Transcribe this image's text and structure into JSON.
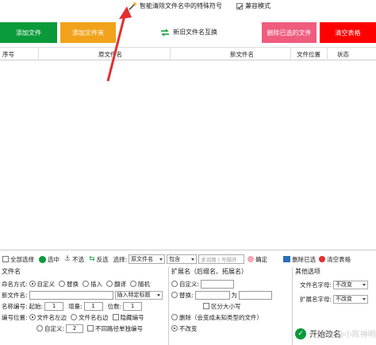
{
  "topbar": {
    "tool_label": "智能清除文件名中的特殊符号",
    "compat_label": "兼容模式",
    "compat_checked": true
  },
  "buttons": {
    "add_file": "添加文件",
    "add_folder": "添加文件夹",
    "swap_names": "新旧文件名互换",
    "delete_selected": "删除已选的文件",
    "clear_table": "清空表格"
  },
  "grid": {
    "columns": [
      "序号",
      "原文件名",
      "新文件名",
      "文件位置",
      "状态"
    ]
  },
  "toolbar2": {
    "select_all": "全部选择",
    "select": "选中",
    "deselect": "不选",
    "invert": "反选",
    "choose_label": "选择:",
    "field_value": "原文件名",
    "mode_value": "包含",
    "multi_placeholder": "多词用 | 号隔开",
    "confirm": "确定",
    "delete_selected": "删除已选",
    "clear_table": "清空表格"
  },
  "left_panel": {
    "title": "文件名",
    "naming_label": "命名方式:",
    "mode_custom": "自定义",
    "mode_replace": "替换",
    "mode_insert": "插入",
    "mode_translate": "翻译",
    "mode_random": "随机",
    "new_name_label": "新文件名:",
    "insert_select": "插入特定标题",
    "numbering_label": "名称编号:",
    "start_label": "起始:",
    "start_value": "1",
    "step_label": "增量:",
    "step_value": "1",
    "digits_label": "位数:",
    "digits_value": "1",
    "pos_label": "编号位置:",
    "pos_left": "文件名左边",
    "pos_right": "文件名右边",
    "hide_number": "隐藏编号",
    "custom_label": "自定义:",
    "custom_value": "2",
    "diff_path": "不同路径单独编号"
  },
  "mid_panel": {
    "title": "扩展名（后缀名、拓展名）",
    "custom": "自定义:",
    "replace": "替换:",
    "to_label": "为",
    "case_sensitive": "区分大小写",
    "delete": "删除（会变成未知类型的文件）",
    "no_change": "不改变"
  },
  "right_panel": {
    "title": "其他选项",
    "filename_case_label": "文件名字母:",
    "filename_case_value": "不改变",
    "ext_case_label": "扩展名字母:",
    "ext_case_value": "不改变"
  },
  "start": {
    "label": "开始改名"
  },
  "watermark": "CSDN @小陈神明",
  "colors": {
    "green": "#0a9a3a",
    "orange": "#f2a21a",
    "pink": "#ef5c7d",
    "red": "#ff0000",
    "arrow": "#e23030"
  }
}
